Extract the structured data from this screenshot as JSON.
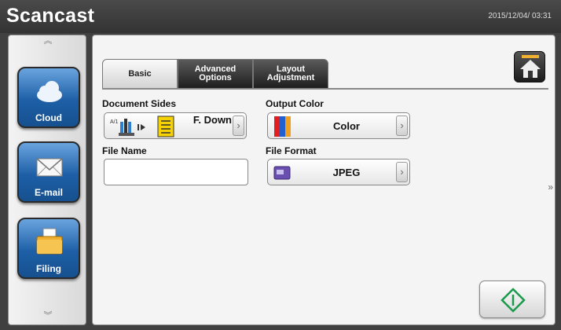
{
  "app": {
    "title": "Scancast",
    "datetime": "2015/12/04/ 03:31"
  },
  "sidebar": {
    "items": [
      {
        "label": "Cloud",
        "icon": "cloud-icon"
      },
      {
        "label": "E-mail",
        "icon": "envelope-icon"
      },
      {
        "label": "Filing",
        "icon": "folder-icon"
      }
    ]
  },
  "tabs": [
    {
      "label": "Basic",
      "selected": true
    },
    {
      "label": "Advanced Options",
      "selected": false
    },
    {
      "label": "Layout Adjustment",
      "selected": false
    }
  ],
  "form": {
    "document_sides": {
      "label": "Document Sides",
      "value": "F. Down"
    },
    "output_color": {
      "label": "Output Color",
      "value": "Color"
    },
    "file_name": {
      "label": "File Name",
      "value": ""
    },
    "file_format": {
      "label": "File Format",
      "value": "JPEG"
    }
  },
  "colors": {
    "accent": "#1d5fa6",
    "start": "#1a9a4a"
  }
}
